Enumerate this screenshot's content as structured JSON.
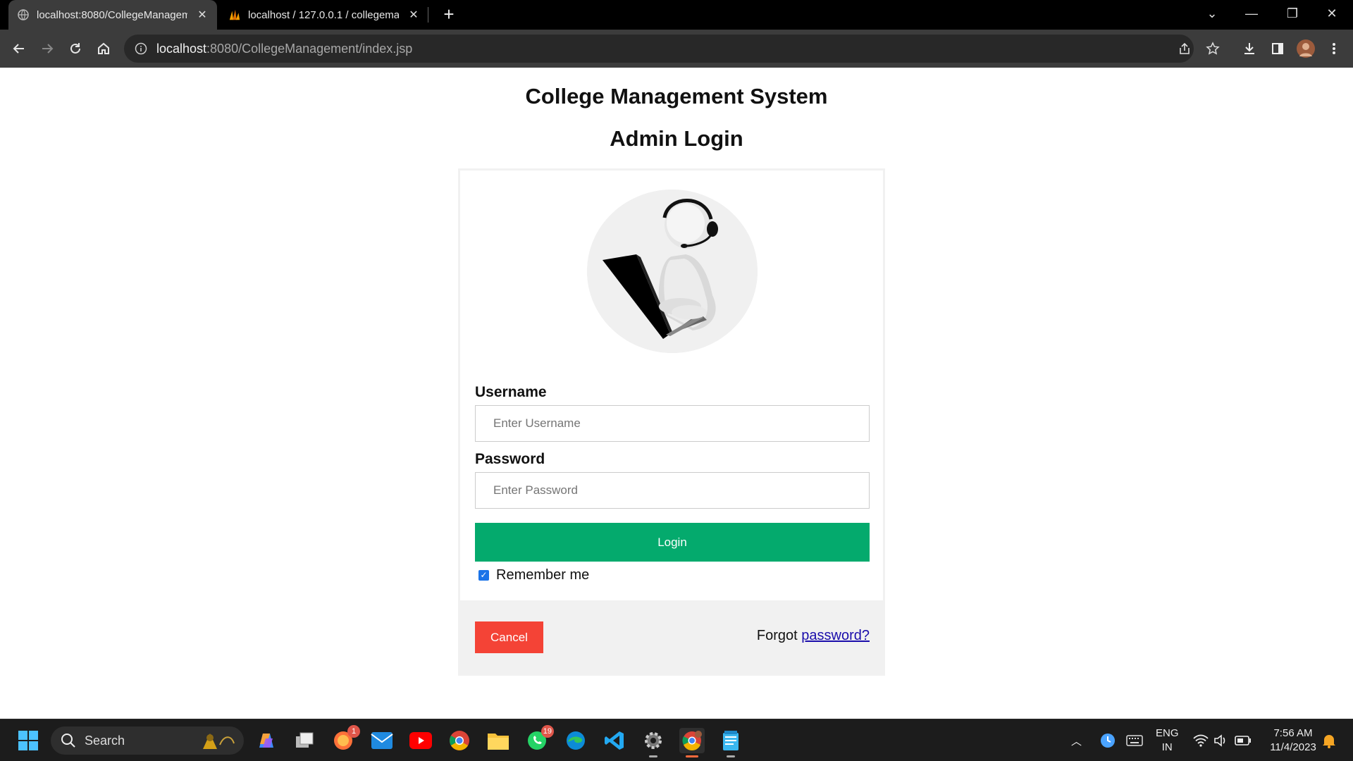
{
  "browser": {
    "tabs": [
      {
        "title": "localhost:8080/CollegeManagem",
        "favicon": "globe-icon"
      },
      {
        "title": "localhost / 127.0.0.1 / collegema",
        "favicon": "phpmyadmin-icon"
      }
    ],
    "url_host": "localhost",
    "url_path": ":8080/CollegeManagement/index.jsp"
  },
  "page": {
    "system_title": "College Management System",
    "login_title": "Admin Login",
    "username_label": "Username",
    "username_placeholder": "Enter Username",
    "password_label": "Password",
    "password_placeholder": "Enter Password",
    "login_button": "Login",
    "remember_label": "Remember me",
    "remember_checked": true,
    "cancel_button": "Cancel",
    "forgot_prefix": "Forgot",
    "forgot_link": "password?"
  },
  "taskbar": {
    "search_label": "Search",
    "badges": {
      "firefox": "1",
      "whatsapp": "19"
    },
    "lang": "ENG",
    "region": "IN",
    "time": "7:56 AM",
    "date": "11/4/2023"
  },
  "colors": {
    "login_green": "#04aa6d",
    "cancel_red": "#f44336",
    "link_blue": "#1a0dab"
  }
}
